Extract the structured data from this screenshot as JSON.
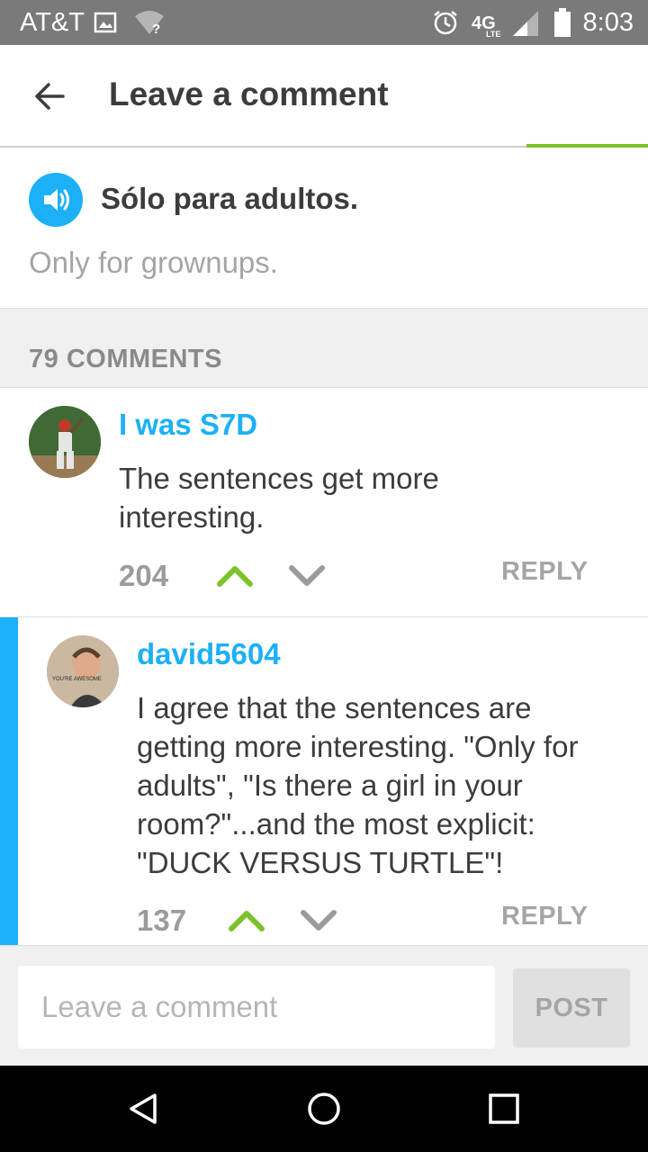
{
  "status_bar": {
    "carrier": "AT&T",
    "time": "8:03",
    "network": "4G LTE"
  },
  "header": {
    "title": "Leave a comment"
  },
  "sentence_card": {
    "sentence": "Sólo para adultos.",
    "translation": "Only for grownups."
  },
  "comments_header": {
    "count_label": "79 COMMENTS"
  },
  "comments": [
    {
      "username": "I was S7D",
      "text": "The sentences get more interesting.",
      "votes": "204",
      "reply_label": "REPLY"
    },
    {
      "username": "david5604",
      "text": "I agree that the sentences are getting more interesting. \"Only for adults\", \"Is there a girl in your room?\"...and the most explicit: \"DUCK VERSUS TURTLE\"!",
      "votes": "137",
      "reply_label": "REPLY",
      "avatar_text": "YOU'RE AWESOME"
    }
  ],
  "composer": {
    "placeholder": "Leave a comment",
    "post_label": "POST"
  },
  "colors": {
    "accent_blue": "#1cb0f6",
    "accent_green": "#7cc22a",
    "text_dark": "#3c3c3c",
    "text_muted": "#a5a5a5"
  },
  "icons": [
    "image-icon",
    "wifi-question-icon",
    "alarm-icon",
    "signal-icon",
    "battery-icon",
    "back-arrow-icon",
    "speaker-icon",
    "upvote-icon",
    "downvote-icon",
    "nav-back-icon",
    "nav-home-icon",
    "nav-recents-icon"
  ]
}
